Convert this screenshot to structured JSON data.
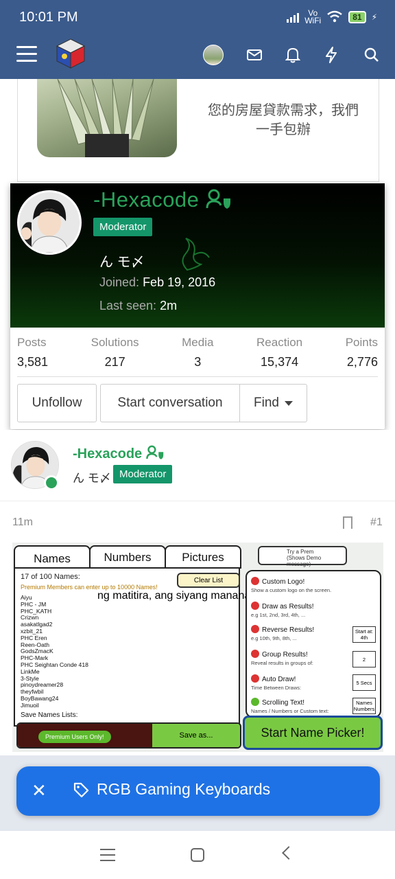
{
  "status": {
    "time": "10:01 PM",
    "net_label_1": "Vo",
    "net_label_2": "WiFi",
    "battery": "81"
  },
  "ad": {
    "text_line1": "您的房屋貸款需求，我們",
    "text_line2": "一手包辦"
  },
  "popup": {
    "username": "-Hexacode",
    "badge": "Moderator",
    "signature": "ん モ〆",
    "joined_label": "Joined:",
    "joined_value": "Feb 19, 2016",
    "seen_label": "Last seen:",
    "seen_value": "2m",
    "stats": [
      {
        "label": "Posts",
        "value": "3,581"
      },
      {
        "label": "Solutions",
        "value": "217"
      },
      {
        "label": "Media",
        "value": "3"
      },
      {
        "label": "Reaction",
        "value": "15,374"
      },
      {
        "label": "Points",
        "value": "2,776"
      }
    ],
    "buttons": {
      "unfollow": "Unfollow",
      "start": "Start conversation",
      "find": "Find"
    }
  },
  "post": {
    "username": "-Hexacode",
    "signature": "ん モ〆",
    "badge": "Moderator",
    "time": "11m",
    "number": "#1"
  },
  "picker": {
    "tabs": [
      "Names",
      "Numbers",
      "Pictures"
    ],
    "count": "17 of 100 Names:",
    "premium_note": "Premium Members can enter  up to 10000 Names!",
    "clear": "Clear List",
    "names": [
      "Aiyu",
      "PHC - JM",
      "PHC_KATH",
      "Crizwn",
      "asakatlgad2",
      "xzbit_21",
      "PHC Eren",
      "Reen-Oath",
      "GodsZmacK",
      "PHC-Mark",
      "PHC Seightan Conde 418",
      "LinkMe",
      "3-Style",
      "pinoydreamer28",
      "theyfwbil",
      "BoyBawang24",
      "Jimuoil"
    ],
    "overlay": "ng matitira, ang siyang mananaloAr",
    "save_lists": "Save Names Lists:",
    "premium_only": "Premium Users Only!",
    "save_as": "Save as...",
    "try_line1": "Try a Prem",
    "try_line2": "(Shows Demo message)",
    "options": [
      {
        "title": "Custom Logo!",
        "desc": "Show a custom logo on the screen."
      },
      {
        "title": "Draw as Results!",
        "desc": "e.g 1st, 2nd, 3rd, 4th, ..."
      },
      {
        "title": "Reverse Results!",
        "desc": "e.g 10th, 9th, 8th, ..."
      },
      {
        "title": "Group Results!",
        "desc": "Reveal results in groups of:"
      },
      {
        "title": "Auto Draw!",
        "desc": "Time Between Draws:"
      },
      {
        "title": "Scrolling Text!",
        "desc": "Names / Numbers or Custom text:"
      }
    ],
    "box_start": "Start at: 4th",
    "box_group": "2",
    "box_secs": "5 Secs",
    "box_names": "Names Numbers",
    "start": "Start Name Picker!"
  },
  "toast": {
    "text": "RGB Gaming Keyboards"
  }
}
